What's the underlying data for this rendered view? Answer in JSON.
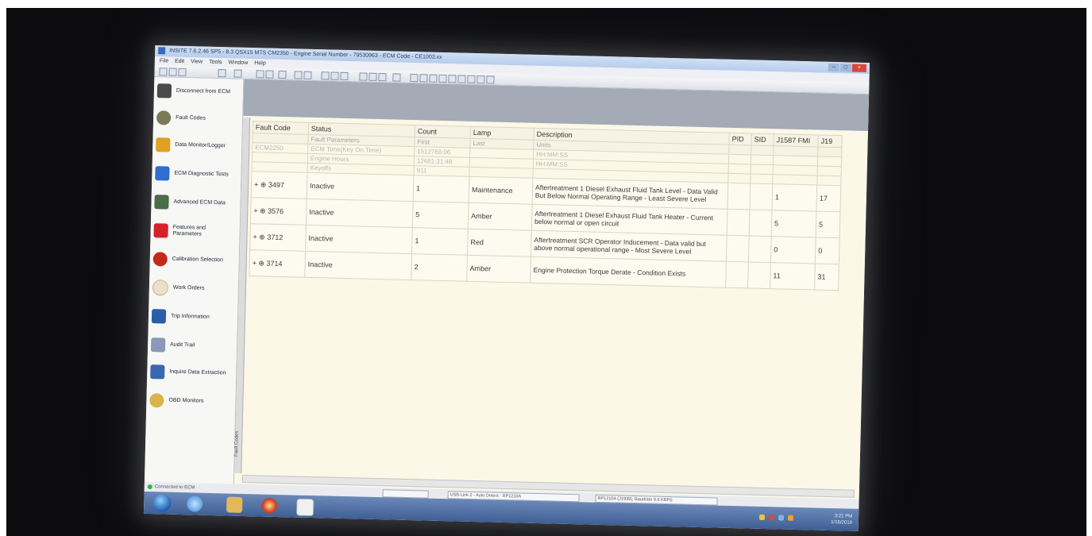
{
  "window": {
    "title": "INSITE 7.6.2.46 SP5 - 8.3 QSX15 MTS CM2350 - Engine Serial Number - 79530963 - ECM Code - CE1003.xx",
    "menu": [
      "File",
      "Edit",
      "View",
      "Tools",
      "Window",
      "Help"
    ]
  },
  "sidebar": {
    "items": [
      {
        "label": "Disconnect from ECM",
        "icon": "disconnect-icon",
        "color": "#4a4a4a"
      },
      {
        "label": "Fault Codes",
        "icon": "fault-codes-icon",
        "color": "#7a7a5a"
      },
      {
        "label": "Data Monitor/Logger",
        "icon": "data-monitor-icon",
        "color": "#e0a020"
      },
      {
        "label": "ECM Diagnostic Tests",
        "icon": "diagnostic-tests-icon",
        "color": "#2f6fd0"
      },
      {
        "label": "Advanced ECM Data",
        "icon": "advanced-data-icon",
        "color": "#4d6c48"
      },
      {
        "label": "Features and Parameters",
        "icon": "features-icon",
        "color": "#d8202a"
      },
      {
        "label": "Calibration Selection",
        "icon": "calibration-icon",
        "color": "#c22a1a"
      },
      {
        "label": "Work Orders",
        "icon": "work-orders-icon",
        "color": "#c9b48a"
      },
      {
        "label": "Trip Information",
        "icon": "trip-info-icon",
        "color": "#2a5ea8"
      },
      {
        "label": "Audit Trail",
        "icon": "audit-trail-icon",
        "color": "#8a9ab8"
      },
      {
        "label": "Inquire Data Extraction",
        "icon": "data-extraction-icon",
        "color": "#3a68b0"
      },
      {
        "label": "OBD Monitors",
        "icon": "obd-monitors-icon",
        "color": "#d9b44a"
      }
    ]
  },
  "fault_table": {
    "headers": [
      "Fault Code",
      "Status",
      "Count",
      "Lamp",
      "Description",
      "PID",
      "SID",
      "J1587 FMI",
      "J19"
    ],
    "subheaders": [
      "",
      "Fault Parameters",
      "First",
      "Last",
      "Units"
    ],
    "parameter_rows": [
      {
        "code": "ECM2250",
        "param": "ECM Time(Key On Time)",
        "first": "1512768:06",
        "last": "",
        "units": "HH:MM:SS"
      },
      {
        "code": "",
        "param": "Engine Hours",
        "first": "12681:31:48",
        "last": "",
        "units": "HH:MM:SS"
      },
      {
        "code": "",
        "param": "Keyoffs",
        "first": "911",
        "last": "",
        "units": ""
      }
    ],
    "rows": [
      {
        "code": "3497",
        "status": "Inactive",
        "count": "1",
        "lamp": "Maintenance",
        "description": "Aftertreatment 1 Diesel Exhaust Fluid Tank Level - Data Valid But Below Normal Operating Range - Least Severe Level",
        "pid": "",
        "sid": "",
        "fmi": "1",
        "j19": "17"
      },
      {
        "code": "3576",
        "status": "Inactive",
        "count": "5",
        "lamp": "Amber",
        "description": "Aftertreatment 1 Diesel Exhaust Fluid Tank Heater - Current below normal or open circuit",
        "pid": "",
        "sid": "",
        "fmi": "5",
        "j19": "5"
      },
      {
        "code": "3712",
        "status": "Inactive",
        "count": "1",
        "lamp": "Red",
        "description": "Aftertreatment SCR Operator Inducement - Data valid but above normal operational range - Most Severe Level",
        "pid": "",
        "sid": "",
        "fmi": "0",
        "j19": "0"
      },
      {
        "code": "3714",
        "status": "Inactive",
        "count": "2",
        "lamp": "Amber",
        "description": "Engine Protection Torque Derate - Condition Exists",
        "pid": "",
        "sid": "",
        "fmi": "11",
        "j19": "31"
      }
    ]
  },
  "statusbar": {
    "connection": "Connected to ECM",
    "adapter": "USB-Link 2 - Auto Detect - RP1210A",
    "protocol": "RP1210A (J1939), Baudrate 9.6 KBPS"
  },
  "vertical_label": "Fault Codes",
  "taskbar": {
    "time": "3:21 PM",
    "date": "1/15/2019"
  }
}
